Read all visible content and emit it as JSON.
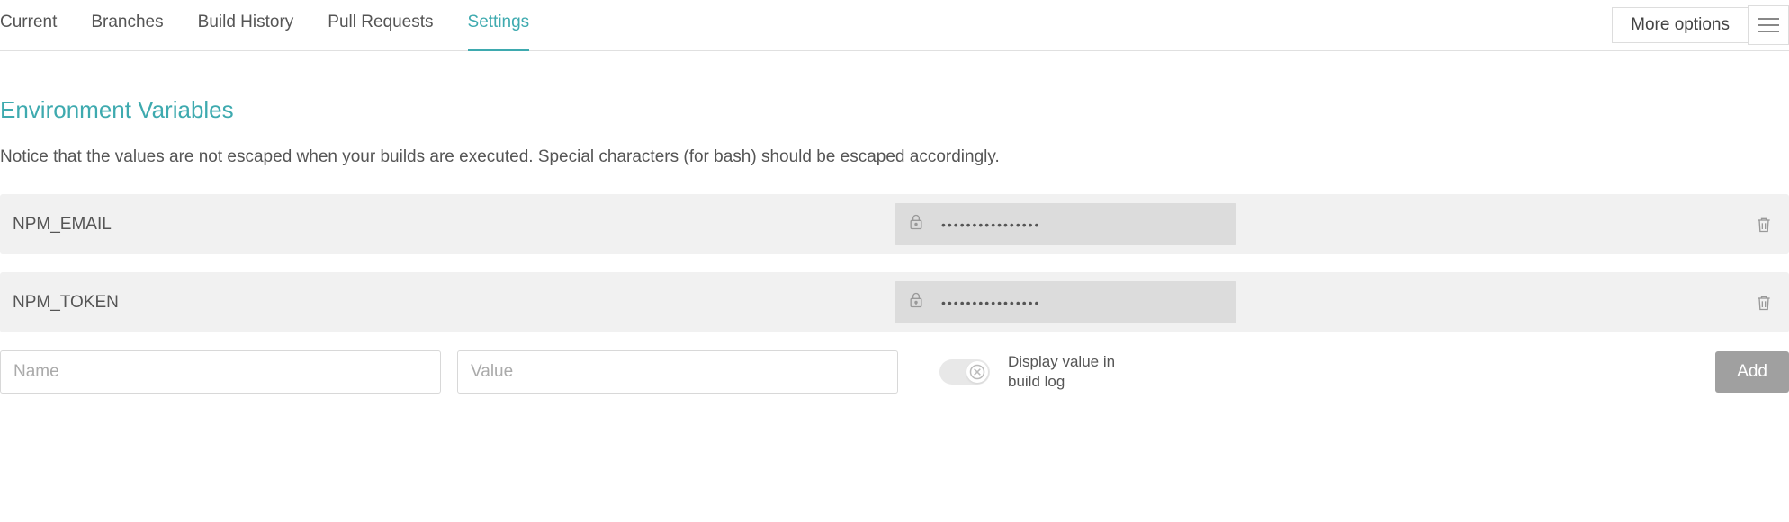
{
  "tabs": {
    "items": [
      "Current",
      "Branches",
      "Build History",
      "Pull Requests",
      "Settings"
    ],
    "active_index": 4
  },
  "top_right": {
    "more_options": "More options"
  },
  "env_section": {
    "title": "Environment Variables",
    "notice": "Notice that the values are not escaped when your builds are executed. Special characters (for bash) should be escaped accordingly."
  },
  "vars": [
    {
      "name": "NPM_EMAIL",
      "masked": "••••••••••••••••"
    },
    {
      "name": "NPM_TOKEN",
      "masked": "••••••••••••••••"
    }
  ],
  "add_form": {
    "name_placeholder": "Name",
    "value_placeholder": "Value",
    "toggle_label": "Display value in build log",
    "toggle_on": false,
    "add_button": "Add"
  }
}
